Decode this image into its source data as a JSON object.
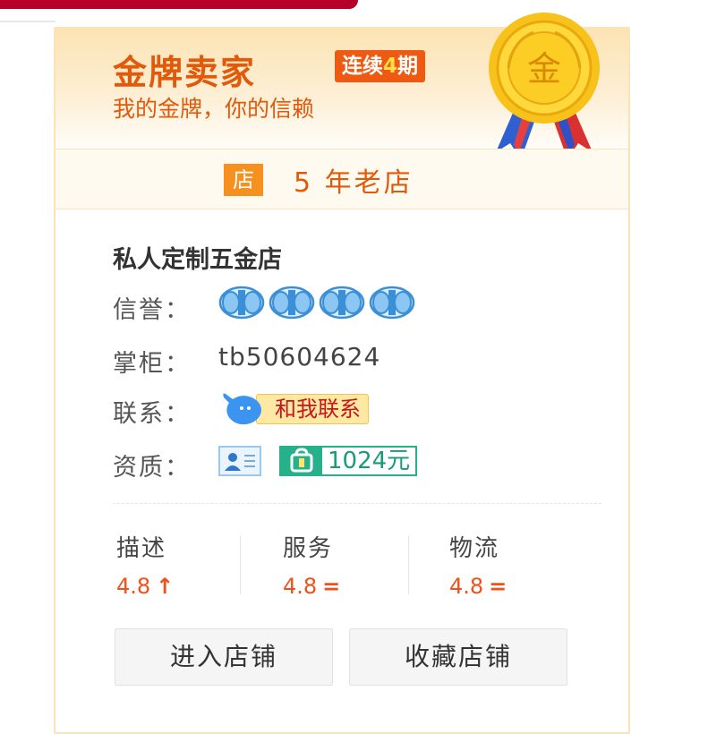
{
  "badge": {
    "title": "金牌卖家",
    "streak_prefix": "连续",
    "streak_num": "4",
    "streak_suffix": "期",
    "slogan": "我的金牌，你的信赖",
    "medal_char": "金"
  },
  "shop_age": {
    "icon_char": "店",
    "text": "5 年老店"
  },
  "shop": {
    "name": "私人定制五金店",
    "reputation_label": "信誉：",
    "crown_count": 4,
    "keeper_label": "掌柜：",
    "keeper_id": "tb50604624",
    "contact_label": "联系：",
    "contact_button": "和我联系",
    "qualification_label": "资质：",
    "deposit_amount": "1024元"
  },
  "ratings": [
    {
      "name": "描述",
      "value": "4.8",
      "trend": "↑"
    },
    {
      "name": "服务",
      "value": "4.8",
      "trend": "="
    },
    {
      "name": "物流",
      "value": "4.8",
      "trend": "="
    }
  ],
  "actions": {
    "enter_shop": "进入店铺",
    "favorite_shop": "收藏店铺"
  },
  "colors": {
    "accent_orange": "#e2590a",
    "score_red": "#f2501a",
    "crown_blue": "#3a8fd6",
    "deposit_green": "#26b08b"
  }
}
